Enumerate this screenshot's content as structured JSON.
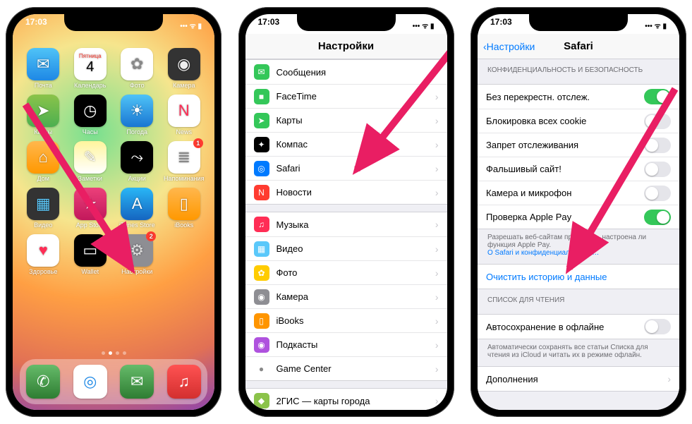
{
  "statusTime": "17:03",
  "phone1": {
    "apps": [
      {
        "label": "Почта",
        "icon": "✉︎",
        "bg": "linear-gradient(#4fc3f7,#1e88e5)"
      },
      {
        "label": "Календарь",
        "text": "4",
        "top": "Пятница",
        "bg": "#fff",
        "fg": "#000"
      },
      {
        "label": "Фото",
        "icon": "✿",
        "bg": "#fff",
        "fg": "#888"
      },
      {
        "label": "Камера",
        "icon": "◉",
        "bg": "#333",
        "fg": "#eee"
      },
      {
        "label": "Карты",
        "icon": "➤",
        "bg": "linear-gradient(#8bc34a,#4caf50)"
      },
      {
        "label": "Часы",
        "icon": "◷",
        "bg": "#000",
        "fg": "#fff"
      },
      {
        "label": "Погода",
        "icon": "☀",
        "bg": "linear-gradient(#4fc3f7,#1976d2)"
      },
      {
        "label": "News",
        "icon": "N",
        "bg": "#fff",
        "fg": "#ff2d55"
      },
      {
        "label": "Дом",
        "icon": "⌂",
        "bg": "linear-gradient(#ffb74d,#ff9800)"
      },
      {
        "label": "Заметки",
        "icon": "✎",
        "bg": "linear-gradient(#fff59d,#fff)"
      },
      {
        "label": "Акции",
        "icon": "⤳",
        "bg": "#000",
        "fg": "#fff"
      },
      {
        "label": "Напоминания",
        "icon": "≣",
        "bg": "#fff",
        "fg": "#888",
        "badge": "1"
      },
      {
        "label": "Видео",
        "icon": "▦",
        "bg": "#333",
        "fg": "#5ac8fa"
      },
      {
        "label": "App Store",
        "icon": "★",
        "bg": "linear-gradient(#ec407a,#c2185b)",
        "fg": "#fff"
      },
      {
        "label": "iTunes Store",
        "icon": "A",
        "bg": "linear-gradient(#29b6f6,#1565c0)",
        "fg": "#fff"
      },
      {
        "label": "iBooks",
        "icon": "▯",
        "bg": "linear-gradient(#ffb74d,#ff9800)",
        "fg": "#fff"
      },
      {
        "label": "Здоровье",
        "icon": "♥",
        "bg": "#fff",
        "fg": "#ff2d55"
      },
      {
        "label": "Wallet",
        "icon": "▭",
        "bg": "#000",
        "fg": "#fff"
      },
      {
        "label": "Настройки",
        "icon": "⚙",
        "bg": "#8e8e93",
        "fg": "#ddd",
        "badge": "2"
      }
    ],
    "dock": [
      {
        "name": "phone-icon",
        "icon": "✆",
        "bg": "linear-gradient(#66bb6a,#2e7d32)"
      },
      {
        "name": "safari-icon",
        "icon": "◎",
        "bg": "#fff",
        "fg": "#1e88e5"
      },
      {
        "name": "messages-icon",
        "icon": "✉",
        "bg": "linear-gradient(#66bb6a,#2e7d32)"
      },
      {
        "name": "music-icon",
        "icon": "♫",
        "bg": "linear-gradient(#ff5252,#d32f2f)"
      }
    ]
  },
  "phone2": {
    "title": "Настройки",
    "group1": [
      {
        "label": "Сообщения",
        "icon": "✉",
        "bg": "#34c759"
      },
      {
        "label": "FaceTime",
        "icon": "■",
        "bg": "#34c759"
      },
      {
        "label": "Карты",
        "icon": "➤",
        "bg": "#34c759"
      },
      {
        "label": "Компас",
        "icon": "✦",
        "bg": "#000"
      },
      {
        "label": "Safari",
        "icon": "◎",
        "bg": "#007aff"
      },
      {
        "label": "Новости",
        "icon": "N",
        "bg": "#ff3b30"
      }
    ],
    "group2": [
      {
        "label": "Музыка",
        "icon": "♫",
        "bg": "#ff2d55"
      },
      {
        "label": "Видео",
        "icon": "▦",
        "bg": "#5ac8fa"
      },
      {
        "label": "Фото",
        "icon": "✿",
        "bg": "#ffcc00"
      },
      {
        "label": "Камера",
        "icon": "◉",
        "bg": "#8e8e93"
      },
      {
        "label": "iBooks",
        "icon": "▯",
        "bg": "#ff9500"
      },
      {
        "label": "Подкасты",
        "icon": "◉",
        "bg": "#af52de"
      },
      {
        "label": "Game Center",
        "icon": "●",
        "bg": "#fff",
        "fg": "#888"
      }
    ],
    "group3": [
      {
        "label": "2ГИС — карты города",
        "icon": "◆",
        "bg": "#8bc34a"
      }
    ]
  },
  "phone3": {
    "back": "Настройки",
    "title": "Safari",
    "sectionPrivacyHeader": "КОНФИДЕНЦИАЛЬНОСТЬ И БЕЗОПАСНОСТЬ",
    "privacy": [
      {
        "label": "Без перекрестн. отслеж.",
        "on": true
      },
      {
        "label": "Блокировка всех cookie",
        "on": false
      },
      {
        "label": "Запрет отслеживания",
        "on": false
      },
      {
        "label": "Фальшивый сайт!",
        "on": false
      },
      {
        "label": "Камера и микрофон",
        "on": false
      },
      {
        "label": "Проверка Apple Pay",
        "on": true
      }
    ],
    "privacyFooter": "Разрешать веб-сайтам проверять, настроена ли функция Apple Pay.",
    "privacyLink": "О Safari и конфиденциальности…",
    "clearLabel": "Очистить историю и данные",
    "readingHeader": "СПИСОК ДЛЯ ЧТЕНИЯ",
    "readingRow": "Автосохранение в офлайне",
    "readingFooter": "Автоматически сохранять все статьи Списка для чтения из iCloud и читать их в режиме офлайн.",
    "advanced": "Дополнения"
  }
}
